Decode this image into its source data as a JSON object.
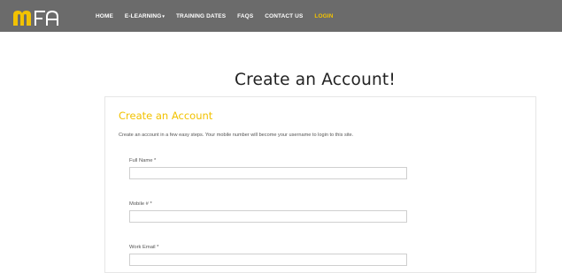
{
  "brand": {
    "logo_text": "mFA",
    "colors": {
      "navbar": "#6b6b6b",
      "accent": "#f2c200",
      "logo": "#f2c200"
    }
  },
  "nav": {
    "items": [
      {
        "label": "HOME"
      },
      {
        "label": "E-LEARNING",
        "caret": "▾"
      },
      {
        "label": "TRAINING DATES"
      },
      {
        "label": "FAQS"
      },
      {
        "label": "CONTACT US"
      },
      {
        "label": "LOGIN",
        "active": true
      }
    ]
  },
  "page": {
    "title": "Create an Account!"
  },
  "form": {
    "title": "Create an Account",
    "description": "Create an account in a few easy steps. Your mobile number will become your username to login to this site.",
    "fields": [
      {
        "label": "Full Name *",
        "value": "",
        "placeholder": ""
      },
      {
        "label": "Mobile # *",
        "value": "",
        "placeholder": ""
      },
      {
        "label": "Work Email *",
        "value": "",
        "placeholder": ""
      }
    ]
  }
}
